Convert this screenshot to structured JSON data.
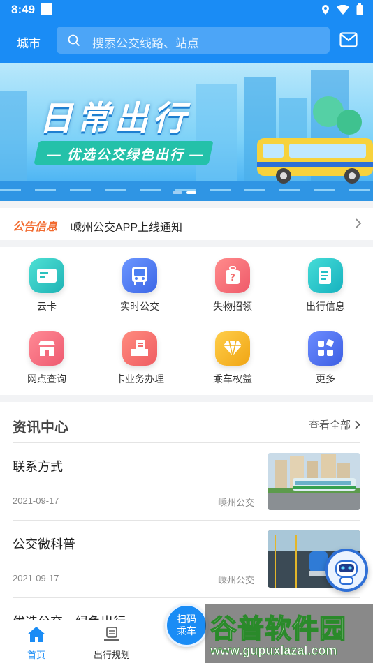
{
  "status": {
    "time": "8:49"
  },
  "header": {
    "city_label": "城市",
    "search_placeholder": "搜索公交线路、站点"
  },
  "banner": {
    "title": "日常出行",
    "subtitle": "— 优选公交绿色出行 —",
    "active_slide": 2,
    "slide_count": 2
  },
  "notice": {
    "tag": "公告信息",
    "text": "嵊州公交APP上线通知"
  },
  "services": [
    {
      "label": "云卡",
      "icon": "card-icon",
      "color": "#2fc7c1"
    },
    {
      "label": "实时公交",
      "icon": "bus-icon",
      "color": "#4a7ef2"
    },
    {
      "label": "失物招领",
      "icon": "luggage-icon",
      "color": "#f36b6b"
    },
    {
      "label": "出行信息",
      "icon": "document-icon",
      "color": "#23c0c6"
    },
    {
      "label": "网点查询",
      "icon": "store-icon",
      "color": "#f3697a"
    },
    {
      "label": "卡业务办理",
      "icon": "card-service-icon",
      "color": "#f36b6b"
    },
    {
      "label": "乘车权益",
      "icon": "diamond-icon",
      "color": "#f3b21f"
    },
    {
      "label": "更多",
      "icon": "apps-icon",
      "color": "#4a72ee"
    }
  ],
  "news": {
    "heading": "资讯中心",
    "view_all": "查看全部",
    "items": [
      {
        "title": "联系方式",
        "date": "2021-09-17",
        "source": "嵊州公交"
      },
      {
        "title": "公交微科普",
        "date": "2021-09-17",
        "source": "嵊州公交"
      },
      {
        "title": "优选公交，绿色出行",
        "date": "",
        "source": ""
      }
    ]
  },
  "tabbar": {
    "home": "首页",
    "trip": "出行规划",
    "scan": "扫码乘车"
  },
  "watermark": {
    "name": "谷普软件园",
    "url": "www.gupuxlazal.com"
  }
}
